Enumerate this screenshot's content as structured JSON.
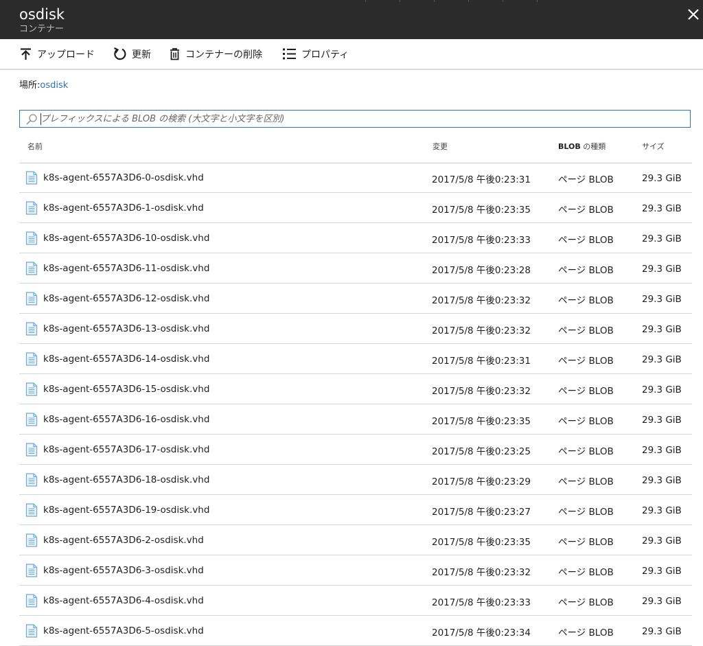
{
  "header": {
    "title": "osdisk",
    "subtitle": "コンテナー",
    "close_icon": "close-icon"
  },
  "toolbar": {
    "upload_label": "アップロード",
    "refresh_label": "更新",
    "delete_label": "コンテナーの削除",
    "properties_label": "プロパティ"
  },
  "location": {
    "label": "場所:",
    "value": "osdisk"
  },
  "search": {
    "placeholder": "プレフィックスによる BLOB の検索 (大文字と小文字を区別)",
    "value": ""
  },
  "table": {
    "columns": {
      "name": "名前",
      "modified": "変更",
      "type_bold": "BLOB",
      "type_rest": " の種類",
      "size": "サイズ"
    },
    "rows": [
      {
        "name": "k8s-agent-6557A3D6-0-osdisk.vhd",
        "modified": "2017/5/8 午後0:23:31",
        "type": "ページ BLOB",
        "size": "29.3 GiB"
      },
      {
        "name": "k8s-agent-6557A3D6-1-osdisk.vhd",
        "modified": "2017/5/8 午後0:23:35",
        "type": "ページ BLOB",
        "size": "29.3 GiB"
      },
      {
        "name": "k8s-agent-6557A3D6-10-osdisk.vhd",
        "modified": "2017/5/8 午後0:23:33",
        "type": "ページ BLOB",
        "size": "29.3 GiB"
      },
      {
        "name": "k8s-agent-6557A3D6-11-osdisk.vhd",
        "modified": "2017/5/8 午後0:23:28",
        "type": "ページ BLOB",
        "size": "29.3 GiB"
      },
      {
        "name": "k8s-agent-6557A3D6-12-osdisk.vhd",
        "modified": "2017/5/8 午後0:23:32",
        "type": "ページ BLOB",
        "size": "29.3 GiB"
      },
      {
        "name": "k8s-agent-6557A3D6-13-osdisk.vhd",
        "modified": "2017/5/8 午後0:23:32",
        "type": "ページ BLOB",
        "size": "29.3 GiB"
      },
      {
        "name": "k8s-agent-6557A3D6-14-osdisk.vhd",
        "modified": "2017/5/8 午後0:23:31",
        "type": "ページ BLOB",
        "size": "29.3 GiB"
      },
      {
        "name": "k8s-agent-6557A3D6-15-osdisk.vhd",
        "modified": "2017/5/8 午後0:23:32",
        "type": "ページ BLOB",
        "size": "29.3 GiB"
      },
      {
        "name": "k8s-agent-6557A3D6-16-osdisk.vhd",
        "modified": "2017/5/8 午後0:23:35",
        "type": "ページ BLOB",
        "size": "29.3 GiB"
      },
      {
        "name": "k8s-agent-6557A3D6-17-osdisk.vhd",
        "modified": "2017/5/8 午後0:23:25",
        "type": "ページ BLOB",
        "size": "29.3 GiB"
      },
      {
        "name": "k8s-agent-6557A3D6-18-osdisk.vhd",
        "modified": "2017/5/8 午後0:23:29",
        "type": "ページ BLOB",
        "size": "29.3 GiB"
      },
      {
        "name": "k8s-agent-6557A3D6-19-osdisk.vhd",
        "modified": "2017/5/8 午後0:23:27",
        "type": "ページ BLOB",
        "size": "29.3 GiB"
      },
      {
        "name": "k8s-agent-6557A3D6-2-osdisk.vhd",
        "modified": "2017/5/8 午後0:23:35",
        "type": "ページ BLOB",
        "size": "29.3 GiB"
      },
      {
        "name": "k8s-agent-6557A3D6-3-osdisk.vhd",
        "modified": "2017/5/8 午後0:23:32",
        "type": "ページ BLOB",
        "size": "29.3 GiB"
      },
      {
        "name": "k8s-agent-6557A3D6-4-osdisk.vhd",
        "modified": "2017/5/8 午後0:23:33",
        "type": "ページ BLOB",
        "size": "29.3 GiB"
      },
      {
        "name": "k8s-agent-6557A3D6-5-osdisk.vhd",
        "modified": "2017/5/8 午後0:23:34",
        "type": "ページ BLOB",
        "size": "29.3 GiB"
      }
    ]
  },
  "colors": {
    "header_bg": "#2b2b2b",
    "accent": "#2b73b6",
    "file_icon": "#6fa8dc"
  }
}
